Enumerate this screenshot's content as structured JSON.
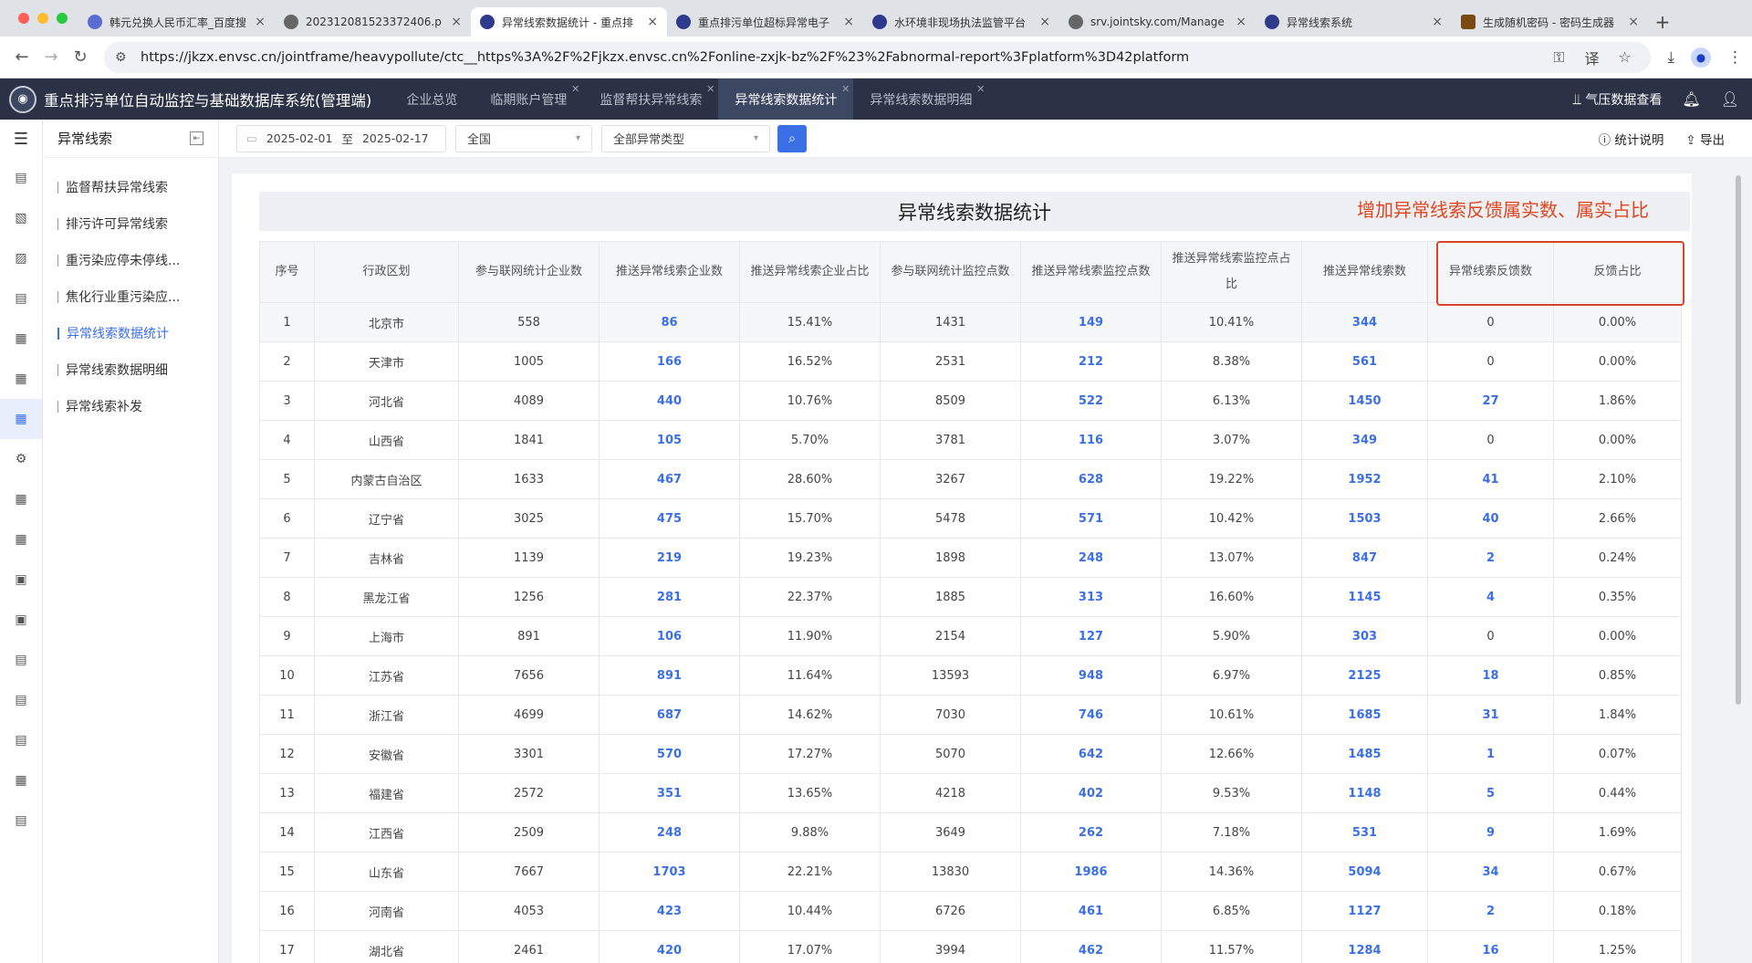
{
  "browser": {
    "tabs": [
      {
        "title": "韩元兑换人民币汇率_百度搜",
        "icon": "paw-icon"
      },
      {
        "title": "202312081523372406.p",
        "icon": "globe-icon"
      },
      {
        "title": "异常线索数据统计 - 重点排",
        "icon": "seal-icon",
        "active": true
      },
      {
        "title": "重点排污单位超标异常电子",
        "icon": "seal-icon"
      },
      {
        "title": "水环境非现场执法监管平台",
        "icon": "seal-icon"
      },
      {
        "title": "srv.jointsky.com/Manage",
        "icon": "globe-icon"
      },
      {
        "title": "异常线索系统",
        "icon": "seal-icon"
      },
      {
        "title": "生成随机密码 - 密码生成器",
        "icon": "password-icon"
      }
    ],
    "url": "https://jkzx.envsc.cn/jointframe/heavypollute/ctc__https%3A%2F%2Fjkzx.envsc.cn%2Fonline-zxjk-bz%2F%23%2Fabnormal-report%3Fplatform%3D42platform"
  },
  "app": {
    "title": "重点排污单位自动监控与基础数据库系统(管理端)",
    "tabs": [
      {
        "label": "企业总览",
        "closable": false
      },
      {
        "label": "临期账户管理",
        "closable": true
      },
      {
        "label": "监督帮扶异常线索",
        "closable": true
      },
      {
        "label": "异常线索数据统计",
        "closable": true,
        "active": true
      },
      {
        "label": "异常线索数据明细",
        "closable": true
      }
    ],
    "pressure_link": "气压数据查看"
  },
  "subnav": {
    "title": "异常线索",
    "items": [
      {
        "label": "监督帮扶异常线索"
      },
      {
        "label": "排污许可异常线索"
      },
      {
        "label": "重污染应停未停线..."
      },
      {
        "label": "焦化行业重污染应..."
      },
      {
        "label": "异常线索数据统计",
        "active": true
      },
      {
        "label": "异常线索数据明细"
      },
      {
        "label": "异常线索补发"
      }
    ]
  },
  "filters": {
    "date_start": "2025-02-01",
    "date_sep": "至",
    "date_end": "2025-02-17",
    "region": "全国",
    "type": "全部异常类型",
    "stat_desc": "统计说明",
    "export": "导出"
  },
  "report": {
    "title": "异常线索数据统计",
    "annotation": "增加异常线索反馈属实数、属实占比",
    "columns": [
      "序号",
      "行政区划",
      "参与联网统计企业数",
      "推送异常线索企业数",
      "推送异常线索企业占比",
      "参与联网统计监控点数",
      "推送异常线索监控点数",
      "推送异常线索监控点占比",
      "推送异常线索数",
      "异常线索反馈数",
      "反馈占比"
    ],
    "rows": [
      [
        "1",
        "北京市",
        "558",
        "86",
        "15.41%",
        "1431",
        "149",
        "10.41%",
        "344",
        "0",
        "0.00%"
      ],
      [
        "2",
        "天津市",
        "1005",
        "166",
        "16.52%",
        "2531",
        "212",
        "8.38%",
        "561",
        "0",
        "0.00%"
      ],
      [
        "3",
        "河北省",
        "4089",
        "440",
        "10.76%",
        "8509",
        "522",
        "6.13%",
        "1450",
        "27",
        "1.86%"
      ],
      [
        "4",
        "山西省",
        "1841",
        "105",
        "5.70%",
        "3781",
        "116",
        "3.07%",
        "349",
        "0",
        "0.00%"
      ],
      [
        "5",
        "内蒙古自治区",
        "1633",
        "467",
        "28.60%",
        "3267",
        "628",
        "19.22%",
        "1952",
        "41",
        "2.10%"
      ],
      [
        "6",
        "辽宁省",
        "3025",
        "475",
        "15.70%",
        "5478",
        "571",
        "10.42%",
        "1503",
        "40",
        "2.66%"
      ],
      [
        "7",
        "吉林省",
        "1139",
        "219",
        "19.23%",
        "1898",
        "248",
        "13.07%",
        "847",
        "2",
        "0.24%"
      ],
      [
        "8",
        "黑龙江省",
        "1256",
        "281",
        "22.37%",
        "1885",
        "313",
        "16.60%",
        "1145",
        "4",
        "0.35%"
      ],
      [
        "9",
        "上海市",
        "891",
        "106",
        "11.90%",
        "2154",
        "127",
        "5.90%",
        "303",
        "0",
        "0.00%"
      ],
      [
        "10",
        "江苏省",
        "7656",
        "891",
        "11.64%",
        "13593",
        "948",
        "6.97%",
        "2125",
        "18",
        "0.85%"
      ],
      [
        "11",
        "浙江省",
        "4699",
        "687",
        "14.62%",
        "7030",
        "746",
        "10.61%",
        "1685",
        "31",
        "1.84%"
      ],
      [
        "12",
        "安徽省",
        "3301",
        "570",
        "17.27%",
        "5070",
        "642",
        "12.66%",
        "1485",
        "1",
        "0.07%"
      ],
      [
        "13",
        "福建省",
        "2572",
        "351",
        "13.65%",
        "4218",
        "402",
        "9.53%",
        "1148",
        "5",
        "0.44%"
      ],
      [
        "14",
        "江西省",
        "2509",
        "248",
        "9.88%",
        "3649",
        "262",
        "7.18%",
        "531",
        "9",
        "1.69%"
      ],
      [
        "15",
        "山东省",
        "7667",
        "1703",
        "22.21%",
        "13830",
        "1986",
        "14.36%",
        "5094",
        "34",
        "0.67%"
      ],
      [
        "16",
        "河南省",
        "4053",
        "423",
        "10.44%",
        "6726",
        "461",
        "6.85%",
        "1127",
        "2",
        "0.18%"
      ],
      [
        "17",
        "湖北省",
        "2461",
        "420",
        "17.07%",
        "3994",
        "462",
        "11.57%",
        "1284",
        "16",
        "1.25%"
      ]
    ]
  }
}
